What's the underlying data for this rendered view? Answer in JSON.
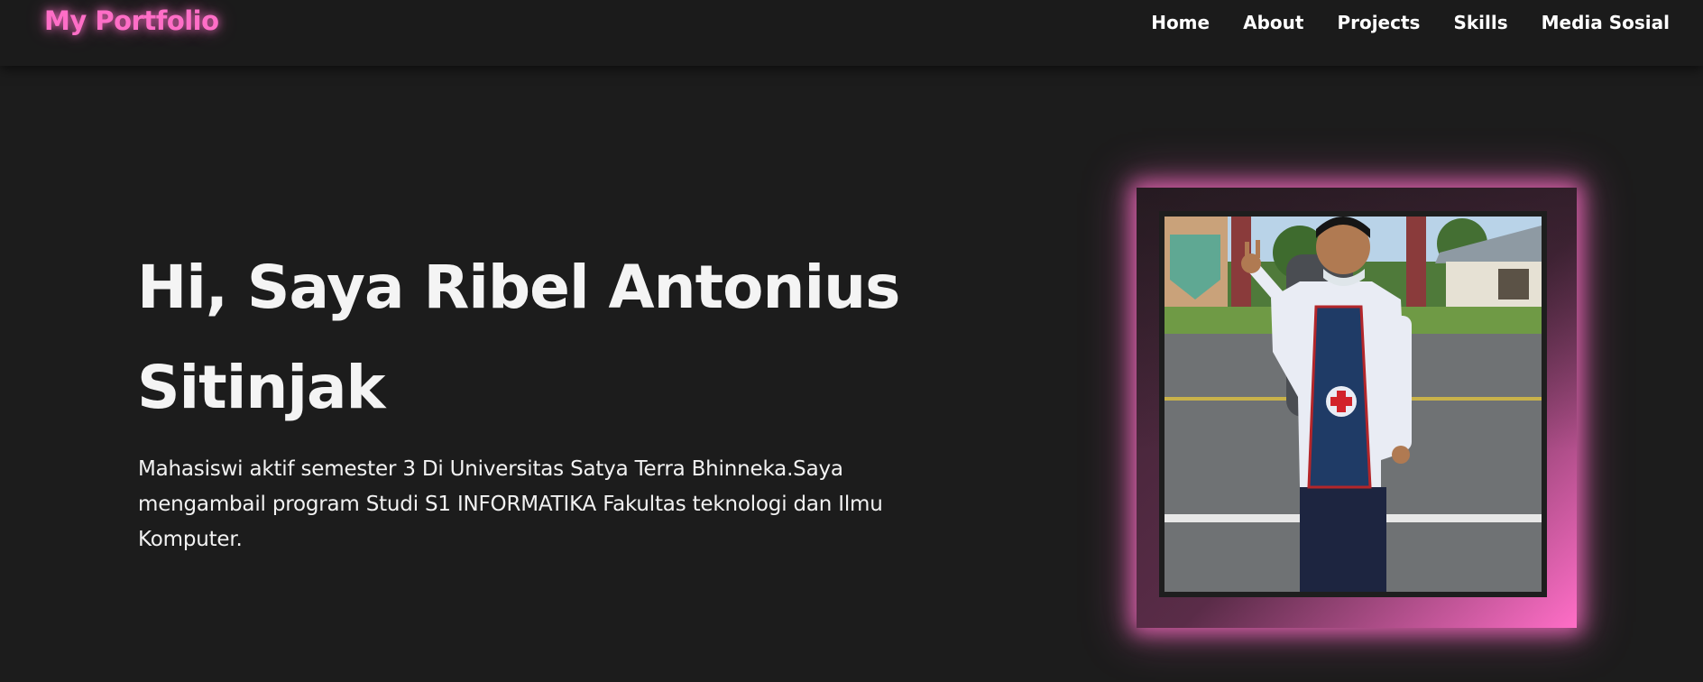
{
  "navbar": {
    "logo": "My Portfolio",
    "links": [
      {
        "label": "Home"
      },
      {
        "label": "About"
      },
      {
        "label": "Projects"
      },
      {
        "label": "Skills"
      },
      {
        "label": "Media Sosial"
      }
    ]
  },
  "hero": {
    "title": "Hi, Saya Ribel Antonius Sitinjak",
    "description": "Mahasiswi aktif semester 3 Di Universitas Satya Terra Bhinneka.Saya mengambail program Studi S1 INFORMATIKA Fakultas teknologi dan Ilmu Komputer.",
    "photo_alt": "profile-photo"
  },
  "colors": {
    "background": "#1c1c1c",
    "navbar": "#1b1b1b",
    "accent": "#ff6ec7",
    "text": "#f4f4f4"
  }
}
